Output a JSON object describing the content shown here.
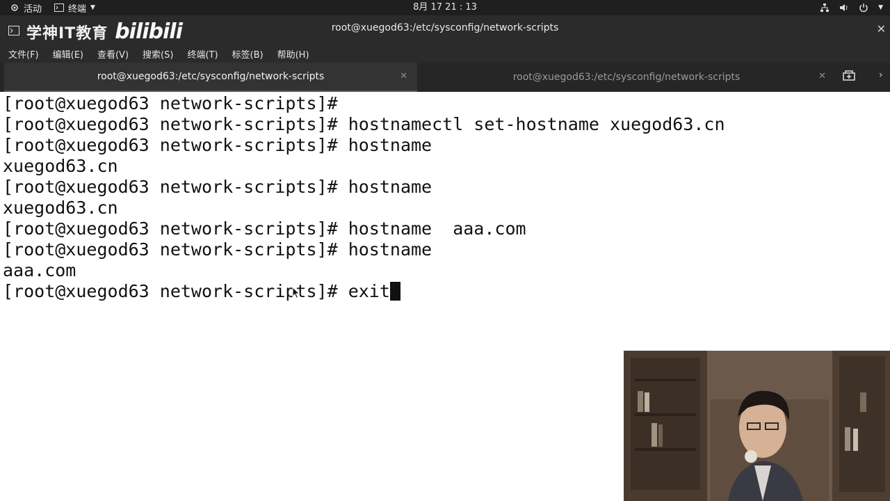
{
  "topbar": {
    "activities": "活动",
    "app_menu": "终端",
    "clock": "8月 17  21 : 13"
  },
  "window": {
    "title": "root@xuegod63:/etc/sysconfig/network-scripts",
    "watermark_text": "学神IT教育",
    "watermark_brand": "bilibili"
  },
  "menubar": {
    "items": [
      "文件(F)",
      "编辑(E)",
      "查看(V)",
      "搜索(S)",
      "终端(T)",
      "标签(B)",
      "帮助(H)"
    ]
  },
  "tabs": [
    {
      "label": "root@xuegod63:/etc/sysconfig/network-scripts",
      "active": true
    },
    {
      "label": "root@xuegod63:/etc/sysconfig/network-scripts",
      "active": false
    }
  ],
  "terminal": {
    "lines": [
      "[root@xuegod63 network-scripts]#",
      "[root@xuegod63 network-scripts]# hostnamectl set-hostname xuegod63.cn",
      "[root@xuegod63 network-scripts]# hostname",
      "xuegod63.cn",
      "[root@xuegod63 network-scripts]# hostname",
      "xuegod63.cn",
      "[root@xuegod63 network-scripts]# hostname  aaa.com",
      "[root@xuegod63 network-scripts]# hostname",
      "aaa.com",
      "[root@xuegod63 network-scripts]# exit"
    ]
  },
  "icons": {
    "activities": "network-icon",
    "terminal": "terminal-icon",
    "tray": [
      "network-wired-icon",
      "volume-icon",
      "power-icon"
    ],
    "new_tab": "new-tab-icon"
  }
}
